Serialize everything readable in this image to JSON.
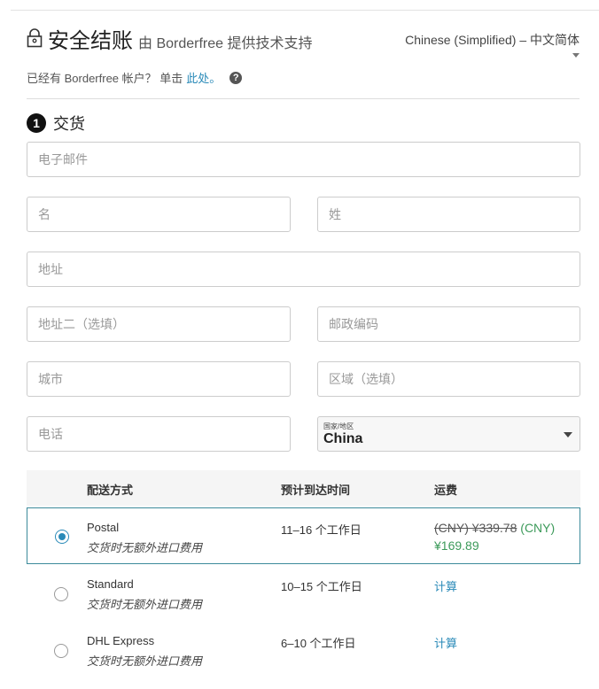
{
  "header": {
    "title": "安全结账",
    "powered": "由 Borderfree 提供技术支持",
    "language": "Chinese (Simplified) – 中文简体"
  },
  "account": {
    "prompt": "已经有 Borderfree 帐户？ 单击",
    "link": "此处。",
    "help": "?"
  },
  "step": {
    "number": "1",
    "title": "交货"
  },
  "fields": {
    "email": "电子邮件",
    "first_name": "名",
    "last_name": "姓",
    "address": "地址",
    "address2": "地址二（选填）",
    "postal": "邮政编码",
    "city": "城市",
    "region": "区域（选填）",
    "phone": "电话",
    "country_label": "国家/地区",
    "country_value": "China"
  },
  "shipping": {
    "headers": [
      "配送方式",
      "预计到达时间",
      "运费"
    ],
    "rows": [
      {
        "name": "Postal",
        "note": "交货时无额外进口费用",
        "time": "11–16 个工作日",
        "old_price": "(CNY) ¥339.78",
        "new_price_prefix": "(CNY)",
        "new_price": "¥169.89",
        "selected": true
      },
      {
        "name": "Standard",
        "note": "交货时无额外进口费用",
        "time": "10–15 个工作日",
        "calc": "计算",
        "selected": false
      },
      {
        "name": "DHL Express",
        "note": "交货时无额外进口费用",
        "time": "6–10 个工作日",
        "calc": "计算",
        "selected": false
      }
    ]
  }
}
